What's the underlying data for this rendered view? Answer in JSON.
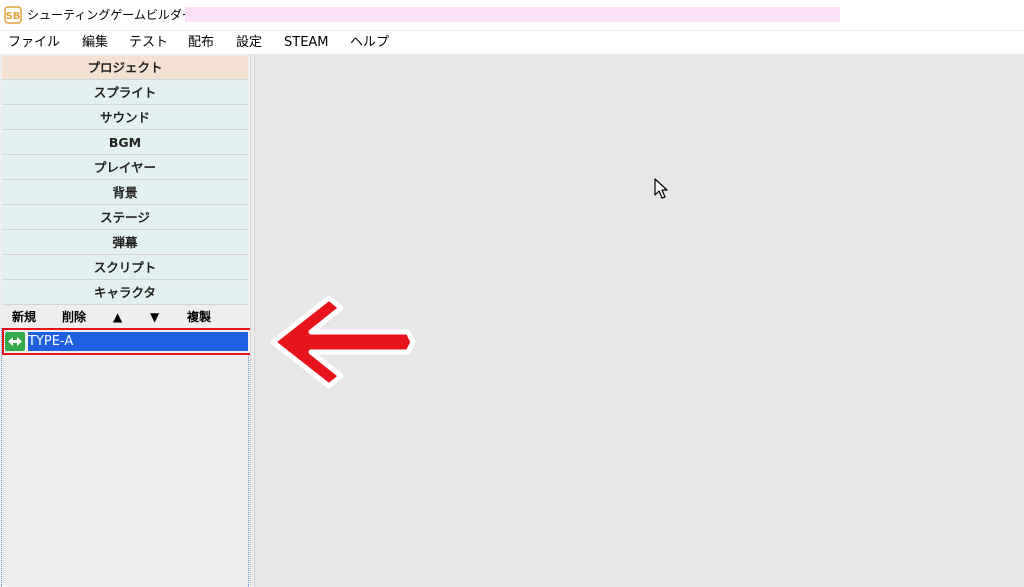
{
  "window": {
    "title": "シューティングゲームビルダー",
    "app_icon": "sb-logo-icon"
  },
  "menu": [
    "ファイル",
    "編集",
    "テスト",
    "配布",
    "設定",
    "STEAM",
    "ヘルプ"
  ],
  "nav": {
    "items": [
      "プロジェクト",
      "スプライト",
      "サウンド",
      "BGM",
      "プレイヤー",
      "背景",
      "ステージ",
      "弾幕",
      "スクリプト",
      "キャラクタ"
    ],
    "active": "プロジェクト"
  },
  "toolbar": {
    "new_label": "新規",
    "delete_label": "削除",
    "up_label": "▲",
    "down_label": "▼",
    "copy_label": "複製"
  },
  "list": {
    "items": [
      "TYPE-A"
    ],
    "selected": "TYPE-A",
    "item_icon": "player-ship-icon"
  },
  "colors": {
    "selection": "#1f5fe0",
    "highlight_box": "#e8141b",
    "annotation_arrow": "#e8141b",
    "active_nav": "#f4e1d1",
    "nav_bg": "#e3f0f0",
    "title_redaction": "#fbe0f7"
  },
  "annotation": {
    "arrow_icon": "red-left-arrow-icon"
  }
}
